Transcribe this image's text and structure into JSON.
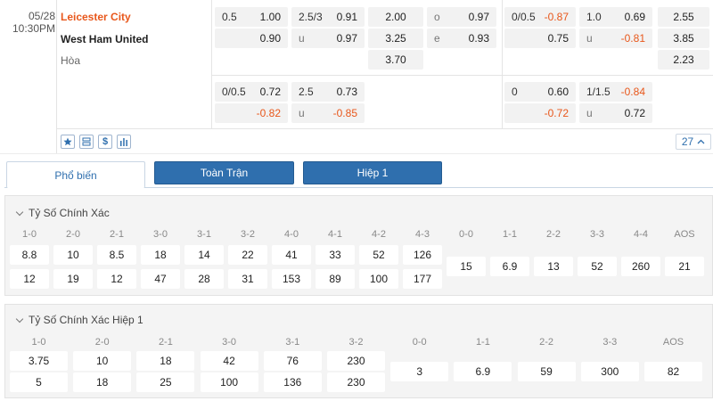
{
  "match": {
    "date": "05/28",
    "time": "10:30PM",
    "home": "Leicester City",
    "away": "West Ham United",
    "draw": "Hòa"
  },
  "odds": {
    "ft_handicap": {
      "line": "0.5",
      "home": "1.00",
      "away": "0.90"
    },
    "ft_ou": {
      "line": "2.5/3",
      "over": "0.91",
      "under_label": "u",
      "under": "0.97"
    },
    "ft_1x2": {
      "home": "2.00",
      "away": "3.25",
      "draw": "3.70"
    },
    "ft_oe": {
      "odd_label": "o",
      "odd": "0.97",
      "even_label": "e",
      "even": "0.93"
    },
    "h1_handicap": {
      "line": "0/0.5",
      "home": "-0.87",
      "away": "0.75"
    },
    "h1_ou": {
      "line": "1.0",
      "over": "0.69",
      "under_label": "u",
      "under": "-0.81"
    },
    "h1_1x2": {
      "home": "2.55",
      "away": "3.85",
      "draw": "2.23"
    },
    "ft_handicap_2": {
      "line": "0/0.5",
      "home": "0.72",
      "away": "-0.82"
    },
    "ft_ou_2": {
      "line": "2.5",
      "over": "0.73",
      "under_label": "u",
      "under": "-0.85"
    },
    "h1_handicap_2": {
      "line": "0",
      "home": "0.60",
      "away": "-0.72"
    },
    "h1_ou_2": {
      "line": "1/1.5",
      "over": "-0.84",
      "under_label": "u",
      "under": "0.72"
    }
  },
  "tools": {
    "icons": [
      "star-icon",
      "layers-icon",
      "dollar-icon",
      "bar-chart-icon"
    ],
    "more_count": "27"
  },
  "tabs": [
    "Phổ biến",
    "Toàn Trận",
    "Hiệp 1"
  ],
  "section1": {
    "title": "Tỷ Số Chính Xác",
    "headers": [
      "1-0",
      "2-0",
      "2-1",
      "3-0",
      "3-1",
      "3-2",
      "4-0",
      "4-1",
      "4-2",
      "4-3",
      "0-0",
      "1-1",
      "2-2",
      "3-3",
      "4-4",
      "AOS"
    ],
    "row_home": [
      "8.8",
      "10",
      "8.5",
      "18",
      "14",
      "22",
      "41",
      "33",
      "52",
      "126"
    ],
    "row_away": [
      "12",
      "19",
      "12",
      "47",
      "28",
      "31",
      "153",
      "89",
      "100",
      "177"
    ],
    "draws": [
      "15",
      "6.9",
      "13",
      "52",
      "260",
      "21"
    ]
  },
  "section2": {
    "title": "Tỷ Số Chính Xác Hiệp 1",
    "headers": [
      "1-0",
      "2-0",
      "2-1",
      "3-0",
      "3-1",
      "3-2",
      "0-0",
      "1-1",
      "2-2",
      "3-3",
      "AOS"
    ],
    "row_home": [
      "3.75",
      "10",
      "18",
      "42",
      "76",
      "230"
    ],
    "row_away": [
      "5",
      "18",
      "25",
      "100",
      "136",
      "230"
    ],
    "draws": [
      "3",
      "6.9",
      "59",
      "300",
      "82"
    ]
  }
}
